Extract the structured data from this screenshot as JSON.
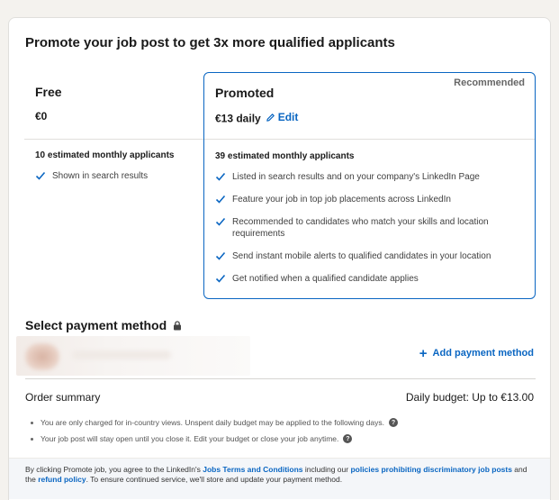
{
  "headline": "Promote your job post to get 3x more qualified applicants",
  "plans": {
    "free": {
      "name": "Free",
      "price": "€0",
      "estimate": "10 estimated monthly applicants",
      "features": [
        "Shown in search results"
      ]
    },
    "promoted": {
      "badge": "Recommended",
      "name": "Promoted",
      "price": "€13 daily",
      "edit_label": "Edit",
      "estimate": "39 estimated monthly applicants",
      "features": [
        "Listed in search results and on your company's LinkedIn Page",
        "Feature your job in top job placements across LinkedIn",
        "Recommended to candidates who match your skills and location requirements",
        "Send instant mobile alerts to qualified candidates in your location",
        "Get notified when a qualified candidate applies"
      ]
    }
  },
  "payment": {
    "title": "Select payment method",
    "add_label": "Add payment method"
  },
  "summary": {
    "label": "Order summary",
    "budget": "Daily budget: Up to €13.00",
    "notes": [
      "You are only charged for in-country views. Unspent daily budget may be applied to the following days.",
      "Your job post will stay open until you close it. Edit your budget or close your job anytime."
    ]
  },
  "legal": {
    "t1": "By clicking Promote job, you agree to the LinkedIn's ",
    "link1": "Jobs Terms and Conditions",
    "t2": " including our ",
    "link2": "policies prohibiting discriminatory job posts",
    "t3": " and the ",
    "link3": "refund policy",
    "t4": ". To ensure continued service, we'll store and update your payment method."
  },
  "colors": {
    "accent": "#0a66c2",
    "text": "#191919",
    "background": "#f4f2ee"
  }
}
